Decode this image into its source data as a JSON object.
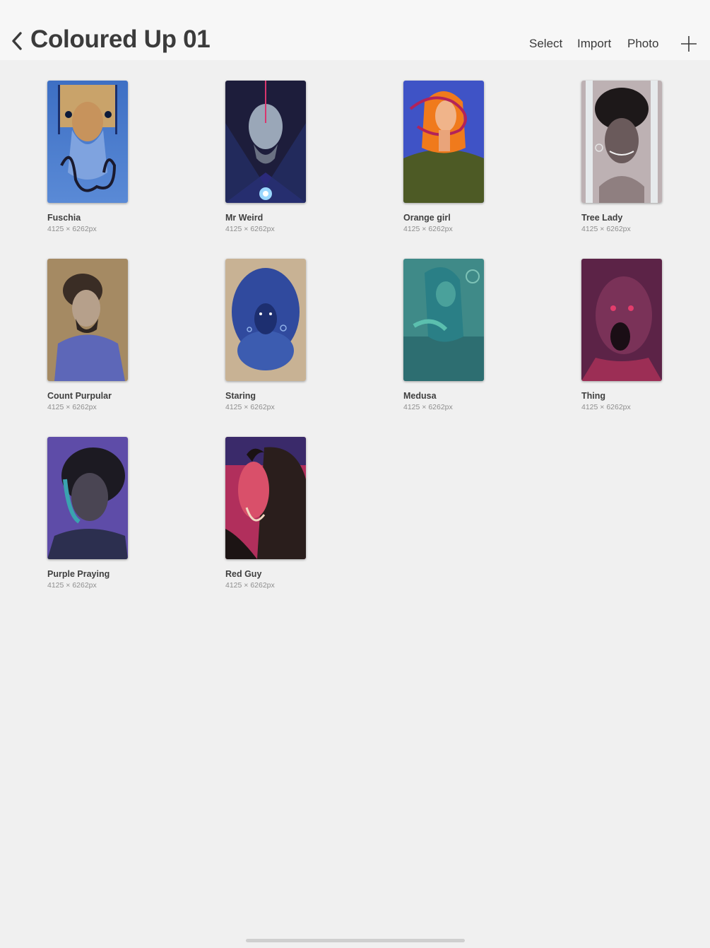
{
  "header": {
    "title": "Coloured Up 01",
    "back_icon": "chevron-left-icon",
    "actions": {
      "select": "Select",
      "import": "Import",
      "photo": "Photo"
    },
    "add_icon": "plus-icon"
  },
  "artworks": [
    {
      "title": "Fuschia",
      "size": "4125 × 6262px"
    },
    {
      "title": "Mr Weird",
      "size": "4125 × 6262px"
    },
    {
      "title": "Orange girl",
      "size": "4125 × 6262px"
    },
    {
      "title": "Tree Lady",
      "size": "4125 × 6262px"
    },
    {
      "title": "Count Purpular",
      "size": "4125 × 6262px"
    },
    {
      "title": "Staring",
      "size": "4125 × 6262px"
    },
    {
      "title": "Medusa",
      "size": "4125 × 6262px"
    },
    {
      "title": "Thing",
      "size": "4125 × 6262px"
    },
    {
      "title": "Purple Praying",
      "size": "4125 × 6262px"
    },
    {
      "title": "Red Guy",
      "size": "4125 × 6262px"
    }
  ],
  "colors": {
    "background": "#f0f0f0",
    "header_background": "#f7f7f7",
    "text": "#3b3b3b",
    "subtext": "#8e8e8e"
  }
}
